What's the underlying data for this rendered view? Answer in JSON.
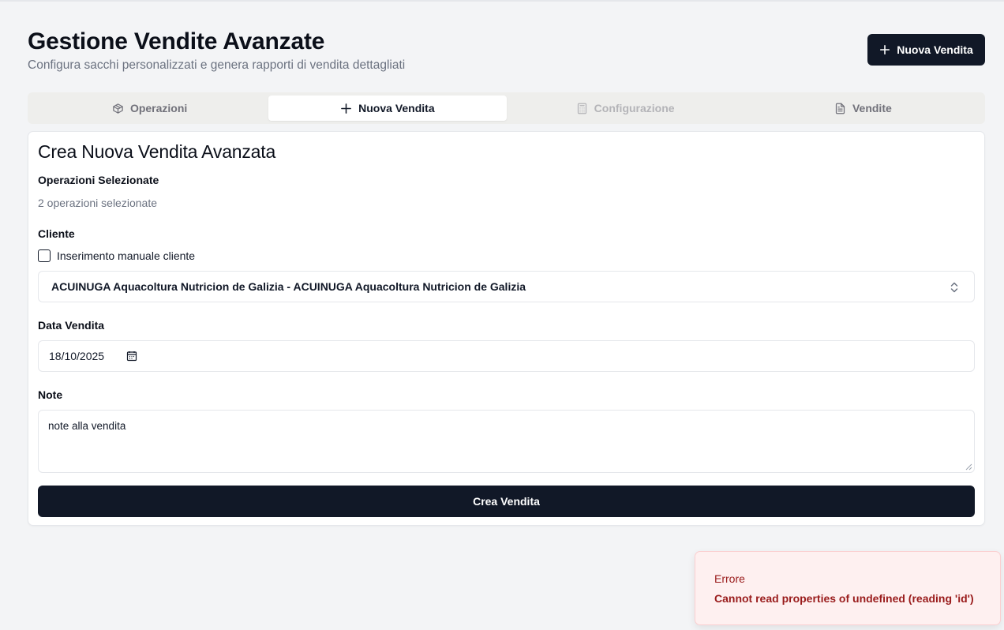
{
  "header": {
    "title": "Gestione Vendite Avanzate",
    "subtitle": "Configura sacchi personalizzati e genera rapporti di vendita dettagliati",
    "new_sale_button": "Nuova Vendita"
  },
  "tabs": [
    {
      "label": "Operazioni",
      "icon": "package-icon",
      "state": "normal"
    },
    {
      "label": "Nuova Vendita",
      "icon": "plus-icon",
      "state": "active"
    },
    {
      "label": "Configurazione",
      "icon": "calculator-icon",
      "state": "disabled"
    },
    {
      "label": "Vendite",
      "icon": "file-text-icon",
      "state": "normal"
    }
  ],
  "form": {
    "title": "Crea Nuova Vendita Avanzata",
    "selected_ops_label": "Operazioni Selezionate",
    "selected_ops_value": "2 operazioni selezionate",
    "client_label": "Cliente",
    "manual_client_label": "Inserimento manuale cliente",
    "manual_client_checked": false,
    "client_value": "ACUINUGA Aquacoltura Nutricion de Galizia - ACUINUGA Aquacoltura Nutricion de Galizia",
    "date_label": "Data Vendita",
    "date_value": "18/10/2025",
    "notes_label": "Note",
    "notes_value": "note alla vendita",
    "submit_label": "Crea Vendita"
  },
  "toast": {
    "title": "Errore",
    "message": "Cannot read properties of undefined (reading 'id')"
  },
  "colors": {
    "primary": "#111827",
    "background": "#f3f4f6",
    "error_bg": "#fef0f0",
    "error_text": "#991b1b"
  }
}
